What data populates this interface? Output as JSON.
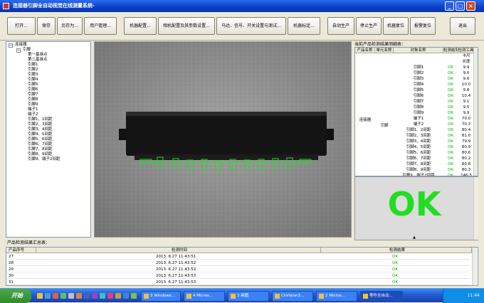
{
  "window": {
    "title": "连接器引脚全自动视觉在线测量系统-",
    "min": "_",
    "max": "□",
    "close": "×"
  },
  "toolbar": {
    "buttons": [
      {
        "label": "打开..."
      },
      {
        "label": "保存"
      },
      {
        "label": "另存为..."
      },
      {
        "label": "用户管理..."
      },
      {
        "label": "机器配置..."
      },
      {
        "label": "相机配置及其参数设置..."
      },
      {
        "label": "马达、信号、开关设置与测试..."
      },
      {
        "label": "机器标定..."
      },
      {
        "label": "自动生产"
      },
      {
        "label": "停止生产"
      },
      {
        "label": "机器复位"
      },
      {
        "label": "报警复位"
      },
      {
        "label": "退出"
      }
    ]
  },
  "tree": {
    "root": "连接器",
    "group": "引脚",
    "items": [
      "第一基准点",
      "第二基准点",
      "引脚1",
      "引脚2",
      "引脚3",
      "引脚4",
      "引脚5",
      "引脚6",
      "引脚7",
      "引脚8",
      "引脚9",
      "端子1",
      "端子2",
      "引脚1、2间距",
      "引脚2、3间距",
      "引脚3、4间距",
      "引脚4、5间距",
      "引脚5、6间距",
      "引脚6、7间距",
      "引脚7、8间距",
      "引脚8、9间距",
      "引脚9、端子2间距"
    ]
  },
  "detail": {
    "title": "当前产品检测结果明细表：",
    "headers": [
      "产品名称",
      "单元名称",
      "对象名称",
      "检测结果",
      "检测工具"
    ],
    "product": "连接器",
    "unit": "引脚",
    "pre_rows": [
      {
        "object": "",
        "result": "",
        "tool": "长度"
      }
    ],
    "rows": [
      {
        "object": "引脚1",
        "result": "OK",
        "tool": "9.9"
      },
      {
        "object": "引脚2",
        "result": "OK",
        "tool": "9.0"
      },
      {
        "object": "引脚3",
        "result": "OK",
        "tool": "9.6"
      },
      {
        "object": "引脚4",
        "result": "OK",
        "tool": "10.0"
      },
      {
        "object": "引脚5",
        "result": "OK",
        "tool": "9.8"
      },
      {
        "object": "引脚6",
        "result": "OK",
        "tool": "10.4"
      },
      {
        "object": "引脚7",
        "result": "OK",
        "tool": "9.1"
      },
      {
        "object": "引脚8",
        "result": "OK",
        "tool": "9.5"
      },
      {
        "object": "引脚9",
        "result": "OK",
        "tool": "9.9"
      },
      {
        "object": "端子1",
        "result": "OK",
        "tool": "70.0"
      },
      {
        "object": "端子2",
        "result": "OK",
        "tool": "70.3"
      },
      {
        "object": "引脚1、2间距",
        "result": "OK",
        "tool": "80.4"
      },
      {
        "object": "引脚2、3间距",
        "result": "OK",
        "tool": "81.0"
      },
      {
        "object": "引脚3、4间距",
        "result": "OK",
        "tool": "79.9"
      },
      {
        "object": "引脚4、5间距",
        "result": "OK",
        "tool": "80.9"
      },
      {
        "object": "引脚5、6间距",
        "result": "OK",
        "tool": "80.6"
      },
      {
        "object": "引脚6、7间距",
        "result": "OK",
        "tool": "80.2"
      },
      {
        "object": "引脚7、8间距",
        "result": "OK",
        "tool": "80.8"
      },
      {
        "object": "引脚8、9间距",
        "result": "OK",
        "tool": "80.3"
      },
      {
        "object": "引脚9、端子2间距",
        "result": "OK",
        "tool": "146.5"
      }
    ],
    "tool_header_sub": "卡尺"
  },
  "ok_display": {
    "text": "OK"
  },
  "summary": {
    "label": "产品检测结果汇总表：",
    "headers": [
      "产品序号",
      "检测时间",
      "检测结果"
    ],
    "rows": [
      {
        "seq": "27",
        "time": "2013. 6.27 11:43:51",
        "result": "OK"
      },
      {
        "seq": "28",
        "time": "2013. 6.27 11:43:52",
        "result": "OK"
      },
      {
        "seq": "29",
        "time": "2013. 6.27 11:43:52",
        "result": "OK"
      },
      {
        "seq": "30",
        "time": "2013. 6.27 11:43:53",
        "result": "OK"
      },
      {
        "seq": "31",
        "time": "2013. 6.27 11:43:53",
        "result": "OK"
      }
    ]
  },
  "taskbar": {
    "start": "开始",
    "tasks": [
      "3 Windows...",
      "4 Micros...",
      "3 画图",
      "CkVision3...",
      "2 Micros...",
      "零件全自动..."
    ],
    "clock": "11:44"
  },
  "colors": {
    "ok_green": "#22dd22",
    "result_green": "#00b000",
    "title_blue": "#0a3fc4"
  }
}
